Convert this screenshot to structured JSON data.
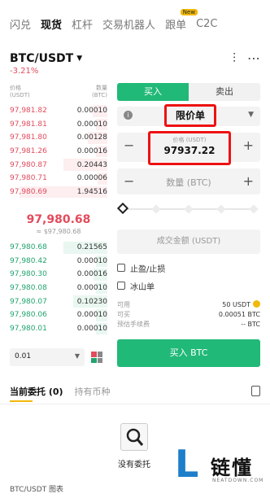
{
  "top_tabs": [
    {
      "label": "闪兑"
    },
    {
      "label": "现货"
    },
    {
      "label": "杠杆"
    },
    {
      "label": "交易机器人"
    },
    {
      "label": "跟单",
      "badge": "New"
    },
    {
      "label": "C2C"
    }
  ],
  "pair": {
    "name": "BTC/USDT",
    "change": "-3.21%"
  },
  "orderbook": {
    "price_header": "价格\n(USDT)",
    "qty_header": "数量\n(BTC)",
    "asks": [
      {
        "price": "97,981.82",
        "qty": "0.00010",
        "depth": 0.15
      },
      {
        "price": "97,981.81",
        "qty": "0.00010",
        "depth": 0.12
      },
      {
        "price": "97,981.80",
        "qty": "0.00128",
        "depth": 0.2
      },
      {
        "price": "97,981.26",
        "qty": "0.00016",
        "depth": 0.12
      },
      {
        "price": "97,980.87",
        "qty": "0.20443",
        "depth": 0.45
      },
      {
        "price": "97,980.71",
        "qty": "0.00006",
        "depth": 0.1
      },
      {
        "price": "97,980.69",
        "qty": "1.94516",
        "depth": 0.9
      }
    ],
    "mid_price": "97,980.68",
    "mid_sub": "≈ $97,980.68",
    "bids": [
      {
        "price": "97,980.68",
        "qty": "0.21565",
        "depth": 0.45
      },
      {
        "price": "97,980.42",
        "qty": "0.00010",
        "depth": 0.12
      },
      {
        "price": "97,980.30",
        "qty": "0.00016",
        "depth": 0.14
      },
      {
        "price": "97,980.08",
        "qty": "0.00010",
        "depth": 0.12
      },
      {
        "price": "97,980.07",
        "qty": "0.10230",
        "depth": 0.35
      },
      {
        "price": "97,980.06",
        "qty": "0.00010",
        "depth": 0.12
      },
      {
        "price": "97,980.01",
        "qty": "0.00010",
        "depth": 0.12
      }
    ],
    "precision": "0.01"
  },
  "trade": {
    "buy_tab": "买入",
    "sell_tab": "卖出",
    "order_type": "限价单",
    "price_label": "价格 (USDT)",
    "price_value": "97937.22",
    "amount_placeholder": "数量 (BTC)",
    "total_placeholder": "成交金额 (USDT)",
    "tp_sl": "止盈/止损",
    "iceberg": "冰山单",
    "available_label": "可用",
    "available_value": "50 USDT",
    "can_buy_label": "可买",
    "can_buy_value": "0.00051 BTC",
    "fee_label": "预估手续费",
    "fee_value": "-- BTC",
    "buy_button": "买入 BTC"
  },
  "bottom": {
    "tab_orders": "当前委托 (0)",
    "tab_holdings": "持有币种",
    "empty_text": "没有委托",
    "chart_label": "BTC/USDT 图表"
  },
  "watermark": {
    "mark": "L",
    "cn": "链懂",
    "en": "NEATDOWN.COM"
  },
  "colors": {
    "buy": "#21b978",
    "sell": "#e34b5c",
    "accent": "#f0b90b",
    "highlight": "#e11111"
  }
}
